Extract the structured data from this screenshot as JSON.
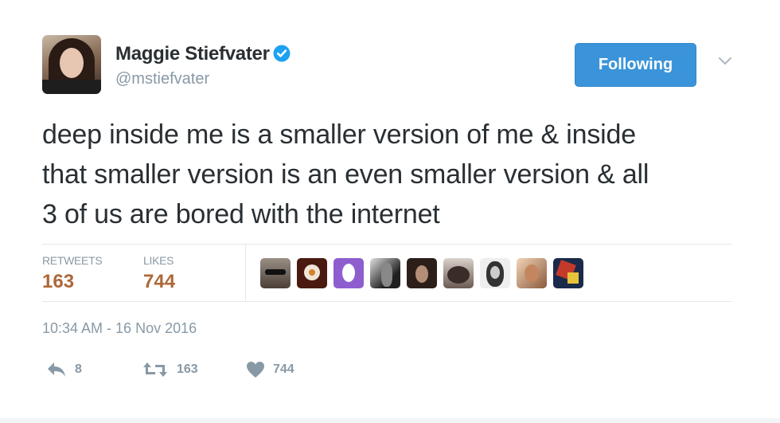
{
  "user": {
    "name": "Maggie Stiefvater",
    "handle": "@mstiefvater",
    "verified": true
  },
  "follow_button": {
    "label": "Following",
    "color": "#3b94d9"
  },
  "tweet": {
    "lines": [
      "deep inside me is a smaller version of me & inside",
      "that smaller version is an even smaller version & all",
      "3 of us are bored with the internet"
    ]
  },
  "stats": {
    "retweets": {
      "label": "RETWEETS",
      "value": "163"
    },
    "likes": {
      "label": "LIKES",
      "value": "744"
    }
  },
  "likers": [
    {
      "icon": "liker-avatar-glasses"
    },
    {
      "icon": "liker-avatar-bb8"
    },
    {
      "icon": "liker-avatar-egg"
    },
    {
      "icon": "liker-avatar-bw-photo"
    },
    {
      "icon": "liker-avatar-dark-hair"
    },
    {
      "icon": "liker-avatar-selfie"
    },
    {
      "icon": "liker-avatar-bw-portrait"
    },
    {
      "icon": "liker-avatar-warm-photo"
    },
    {
      "icon": "liker-avatar-art"
    }
  ],
  "timestamp": "10:34 AM - 16 Nov 2016",
  "actions": {
    "reply": {
      "icon": "reply-icon",
      "count": "8"
    },
    "retweet": {
      "icon": "retweet-icon",
      "count": "163"
    },
    "like": {
      "icon": "heart-icon",
      "count": "744"
    }
  },
  "colors": {
    "accent": "#3b94d9",
    "stat_value": "#ac6838",
    "muted": "#8899a6",
    "text": "#292f33"
  }
}
